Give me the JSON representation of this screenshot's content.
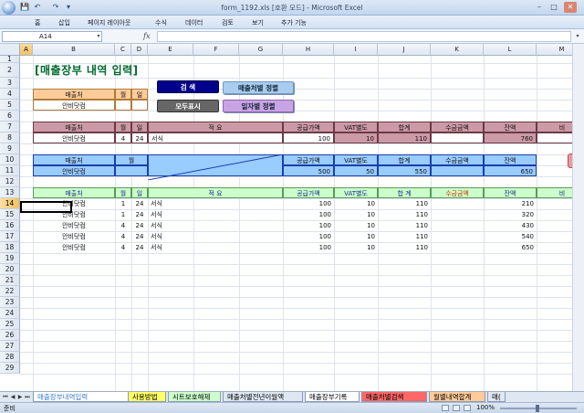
{
  "window": {
    "title": "form_1192.xls [호환 모드] - Microsoft Excel",
    "min": "–",
    "max": "□",
    "close": "✕"
  },
  "qat": {
    "save": "💾",
    "undo": "↶",
    "redo": "↷",
    "more": "▾"
  },
  "ribbon": {
    "tabs": [
      "홈",
      "삽입",
      "페이지 레이아웃",
      "수식",
      "데이터",
      "검토",
      "보기",
      "추가 기능"
    ]
  },
  "formula": {
    "cell": "A14",
    "fx": "fx",
    "value": ""
  },
  "columns": [
    "A",
    "B",
    "C",
    "D",
    "E",
    "F",
    "G",
    "H",
    "I",
    "J",
    "K",
    "L",
    "M"
  ],
  "rows": [
    "1",
    "2",
    "3",
    "4",
    "5",
    "6",
    "7",
    "8",
    "9",
    "10",
    "11",
    "12",
    "13",
    "14",
    "15",
    "16",
    "17",
    "18",
    "19",
    "20",
    "21",
    "22",
    "23",
    "24",
    "25",
    "26",
    "27",
    "28",
    "29"
  ],
  "sheet": {
    "title": "[매출장부 내역 입력]",
    "search_box": {
      "h_client": "매출처",
      "h_month": "월",
      "h_day": "일",
      "client": "안비닷컴"
    },
    "buttons": {
      "search": "검  색",
      "show_all": "모두표시",
      "sort_client": "매출처별 정렬",
      "sort_date": "일자별 정렬"
    },
    "entry": {
      "headers": [
        "매출처",
        "월",
        "일",
        "적 요",
        "공급가액",
        "VAT별도",
        "합계",
        "수금금액",
        "잔액",
        "비"
      ],
      "row": [
        "안비닷컴",
        "4",
        "24",
        "서식",
        "100",
        "10",
        "110",
        "",
        "760",
        ""
      ]
    },
    "summary": {
      "headers": [
        "매출처",
        "월",
        "공급가액",
        "VAT별도",
        "합계",
        "수금금액",
        "잔액"
      ],
      "row": [
        "안비닷컴",
        "",
        "500",
        "50",
        "550",
        "",
        "650"
      ]
    },
    "list": {
      "headers": [
        "매출처",
        "월",
        "일",
        "적 요",
        "공급가액",
        "VAT별도",
        "합 계",
        "수금금액",
        "잔액",
        "비"
      ],
      "rows": [
        [
          "안비닷컴",
          "1",
          "24",
          "서식",
          "100",
          "10",
          "110",
          "",
          "210"
        ],
        [
          "안비닷컴",
          "1",
          "24",
          "서식",
          "100",
          "10",
          "110",
          "",
          "320"
        ],
        [
          "안비닷컴",
          "4",
          "24",
          "서식",
          "100",
          "10",
          "110",
          "",
          "430"
        ],
        [
          "안비닷컴",
          "4",
          "24",
          "서식",
          "100",
          "10",
          "110",
          "",
          "540"
        ],
        [
          "안비닷컴",
          "4",
          "24",
          "서식",
          "100",
          "10",
          "110",
          "",
          "650"
        ]
      ]
    }
  },
  "sheet_tabs": [
    "매출장부내역입력",
    "사용방법",
    "시트보호해제",
    "매출처별전년이월액",
    "매출장부기록",
    "매출처별검색",
    "월별내역합계",
    "매("
  ],
  "status": {
    "text": "준비",
    "zoom": "100%"
  },
  "colors": {
    "title_green": "#006a2e",
    "entry_header": "#cc9aa6",
    "summary_fill": "#99ccff",
    "list_header": "#ccffcc",
    "summary_border": "#1a3fa8"
  }
}
